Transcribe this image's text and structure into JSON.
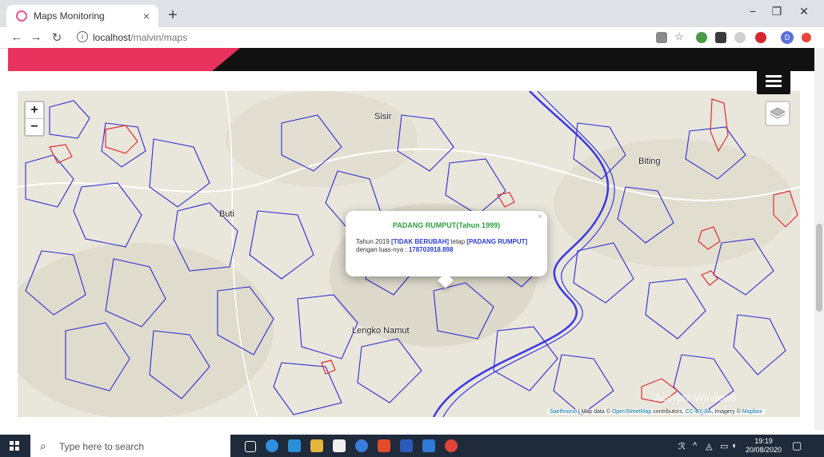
{
  "browser": {
    "tab_title": "Maps Monitoring",
    "tab_close": "×",
    "new_tab": "+",
    "url_host": "localhost",
    "url_path": "/malvin/maps",
    "profile_initial": "D",
    "min": "−",
    "restore": "❐",
    "close": "✕"
  },
  "map": {
    "zoom_in": "+",
    "zoom_out": "−",
    "places": [
      "Sisir",
      "Biting",
      "Buti",
      "Lengko Namut"
    ],
    "attribution": {
      "a": "Saethnono",
      "b": " | Map data © ",
      "c": "OpenStreetMap",
      "d": " contributors, ",
      "e": "CC-BY-SA",
      "f": ", Imagery © ",
      "g": "Mapbox"
    },
    "watermark": "Activate Windows",
    "colors": {
      "polygon_blue": "#2f2fd0",
      "polygon_red": "#e03030",
      "river": "#3a3ae0"
    }
  },
  "popup": {
    "title": "PADANG RUMPUT(Tahun 1999)",
    "line1_prefix": "Tahun 2019 ",
    "status": "[TIDAK BERUBAH]",
    "line1_mid": " tetap ",
    "category": "[PADANG RUMPUT]",
    "line2_prefix": "dengan luas-nya : ",
    "area": "178703918.898",
    "close": "×"
  },
  "taskbar": {
    "search_placeholder": "Type here to search",
    "time": "19:19",
    "date": "20/08/2020"
  }
}
